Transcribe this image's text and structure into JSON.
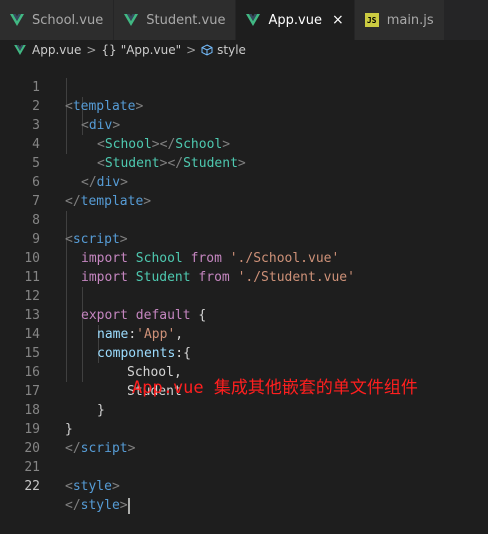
{
  "tabs": [
    {
      "label": "School.vue",
      "icon": "vue-icon",
      "active": false
    },
    {
      "label": "Student.vue",
      "icon": "vue-icon",
      "active": false
    },
    {
      "label": "App.vue",
      "icon": "vue-icon",
      "active": true
    },
    {
      "label": "main.js",
      "icon": "js-icon",
      "active": false
    }
  ],
  "breadcrumb": {
    "file": "App.vue",
    "symbol": "\"App.vue\"",
    "braces": "{}",
    "section": "style",
    "separator": ">"
  },
  "icons": {
    "js_badge": "JS",
    "close": "×"
  },
  "editor": {
    "current_line": 22,
    "lines": [
      {
        "num": "1"
      },
      {
        "num": "2"
      },
      {
        "num": "3"
      },
      {
        "num": "4"
      },
      {
        "num": "5"
      },
      {
        "num": "6"
      },
      {
        "num": "7"
      },
      {
        "num": "8"
      },
      {
        "num": "9"
      },
      {
        "num": "10"
      },
      {
        "num": "11"
      },
      {
        "num": "12"
      },
      {
        "num": "13"
      },
      {
        "num": "14"
      },
      {
        "num": "15"
      },
      {
        "num": "16"
      },
      {
        "num": "17"
      },
      {
        "num": "18"
      },
      {
        "num": "19"
      },
      {
        "num": "20"
      },
      {
        "num": "21"
      },
      {
        "num": "22"
      }
    ],
    "tokens": {
      "lt": "<",
      "gt": ">",
      "lts": "</",
      "template": "template",
      "div": "div",
      "School": "School",
      "Student": "Student",
      "script": "script",
      "style": "style",
      "import": "import",
      "from": "from",
      "school_path": "'./School.vue'",
      "student_path": "'./Student.vue'",
      "export": "export",
      "default": "default",
      "lbrace": "{",
      "rbrace": "}",
      "name": "name",
      "colon": ":",
      "app_str": "'App'",
      "comma": ",",
      "components": "components",
      "school_comma": "School,",
      "student_plain": "Student",
      "space": " "
    }
  },
  "annotation": "App.vue 集成其他嵌套的单文件组件",
  "colors": {
    "tag": "#569cd6",
    "keyword": "#c586c0",
    "component": "#4ec9b0",
    "string": "#ce9178",
    "property": "#9cdcfe",
    "annotation": "#ff1f1f",
    "vue_green": "#41b883"
  }
}
